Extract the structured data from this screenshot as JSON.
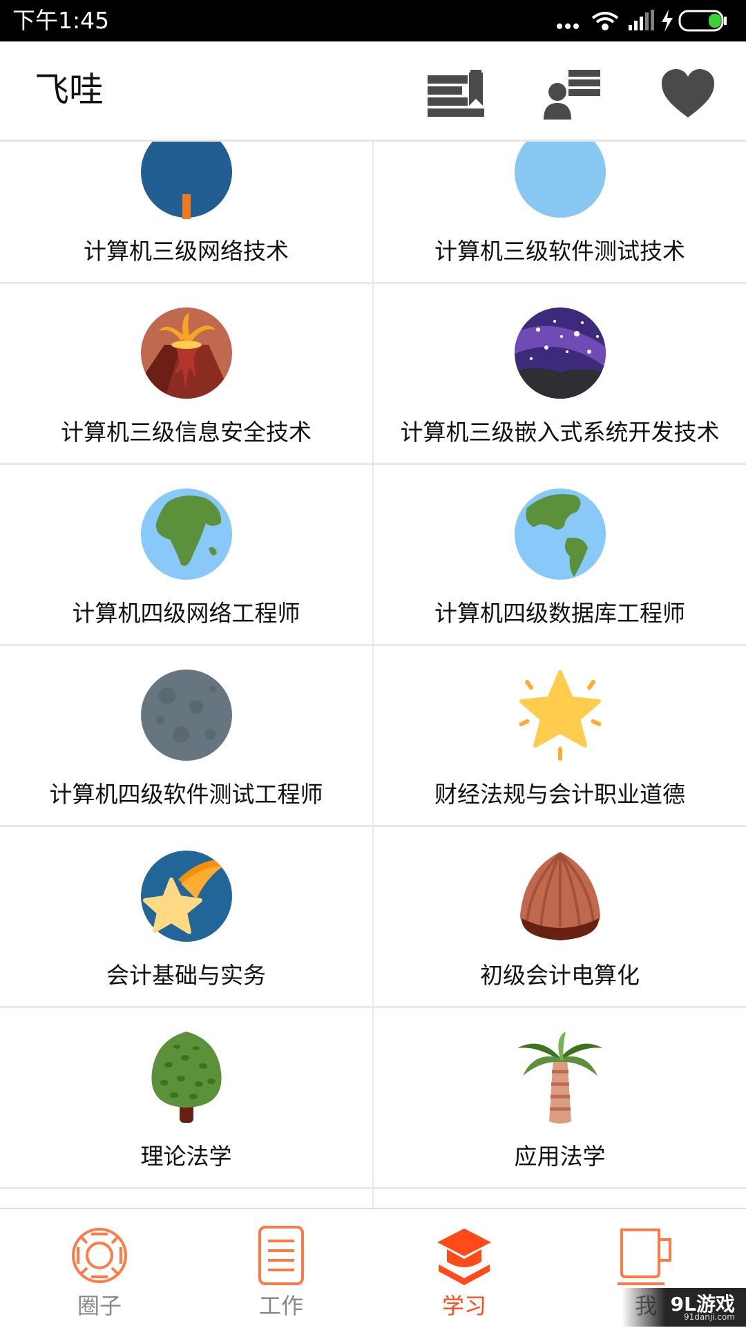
{
  "status_bar": {
    "time": "下午1:45",
    "signal_dots": "•••"
  },
  "app_bar": {
    "title": "飞哇",
    "actions": [
      "bookmark-list-icon",
      "contacts-list-icon",
      "heart-icon"
    ]
  },
  "subjects": [
    {
      "label": "计算机三级网络技术",
      "icon": "globe-partial-icon"
    },
    {
      "label": "计算机三级软件测试技术",
      "icon": "planet-partial-icon"
    },
    {
      "label": "计算机三级信息安全技术",
      "icon": "volcano-icon"
    },
    {
      "label": "计算机三级嵌入式系统开发技术",
      "icon": "night-sky-icon"
    },
    {
      "label": "计算机四级网络工程师",
      "icon": "earth-africa-icon"
    },
    {
      "label": "计算机四级数据库工程师",
      "icon": "earth-americas-icon"
    },
    {
      "label": "计算机四级软件测试工程师",
      "icon": "moon-icon"
    },
    {
      "label": "财经法规与会计职业道德",
      "icon": "glowing-star-icon"
    },
    {
      "label": "会计基础与实务",
      "icon": "shooting-star-icon"
    },
    {
      "label": "初级会计电算化",
      "icon": "chestnut-icon"
    },
    {
      "label": "理论法学",
      "icon": "tree-icon"
    },
    {
      "label": "应用法学",
      "icon": "palm-tree-icon"
    },
    {
      "label": "",
      "icon": "cactus-icon"
    },
    {
      "label": "",
      "icon": "mushroom-icon"
    }
  ],
  "bottom_nav": [
    {
      "label": "圈子",
      "icon": "lifebuoy-icon",
      "active": false
    },
    {
      "label": "工作",
      "icon": "document-icon",
      "active": false
    },
    {
      "label": "学习",
      "icon": "graduation-cap-icon",
      "active": true
    },
    {
      "label": "我",
      "icon": "coffee-cup-icon",
      "active": false
    }
  ],
  "watermark": {
    "brand": "9L游戏",
    "site": "91danji.com"
  },
  "colors": {
    "accent": "#ff4a1a",
    "nav_inactive_icon": "#ff7a45",
    "divider": "#e9e9e9",
    "appbar_icon": "#4a4a4a"
  }
}
